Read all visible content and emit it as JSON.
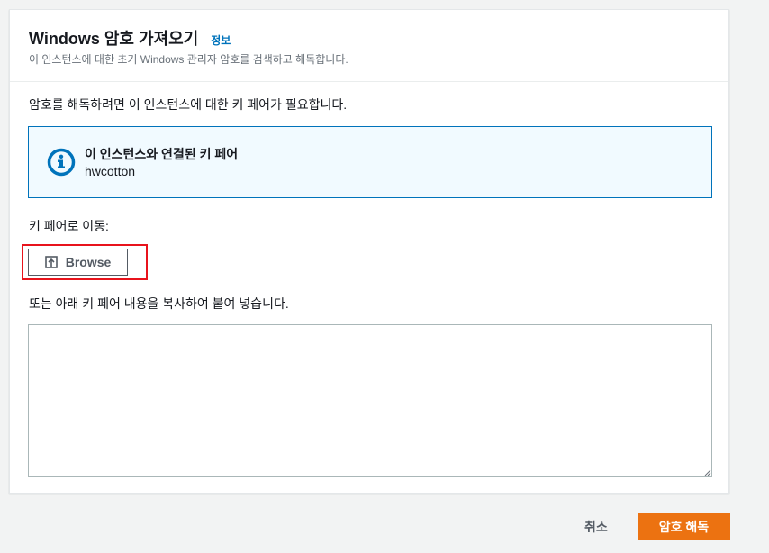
{
  "header": {
    "title": "Windows 암호 가져오기",
    "info_link": "정보",
    "subtitle": "이 인스턴스에 대한 초기 Windows 관리자 암호를 검색하고 해독합니다."
  },
  "body": {
    "intro": "암호를 해독하려면 이 인스턴스에 대한 키 페어가 필요합니다.",
    "info_box": {
      "icon": "info-circle-icon",
      "title": "이 인스턴스와 연결된 키 페어",
      "value": "hwcotton"
    },
    "browse_label_text": "키 페어로 이동:",
    "browse_button": "Browse",
    "paste_label": "또는 아래 키 페어 내용을 복사하여 붙여 넣습니다.",
    "key_textarea": {
      "value": "",
      "placeholder": ""
    }
  },
  "footer": {
    "cancel": "취소",
    "decrypt": "암호 해독"
  },
  "colors": {
    "accent": "#0073bb",
    "primary_button": "#ec7211",
    "highlight": "#e8131c",
    "info_bg": "#f1faff"
  }
}
